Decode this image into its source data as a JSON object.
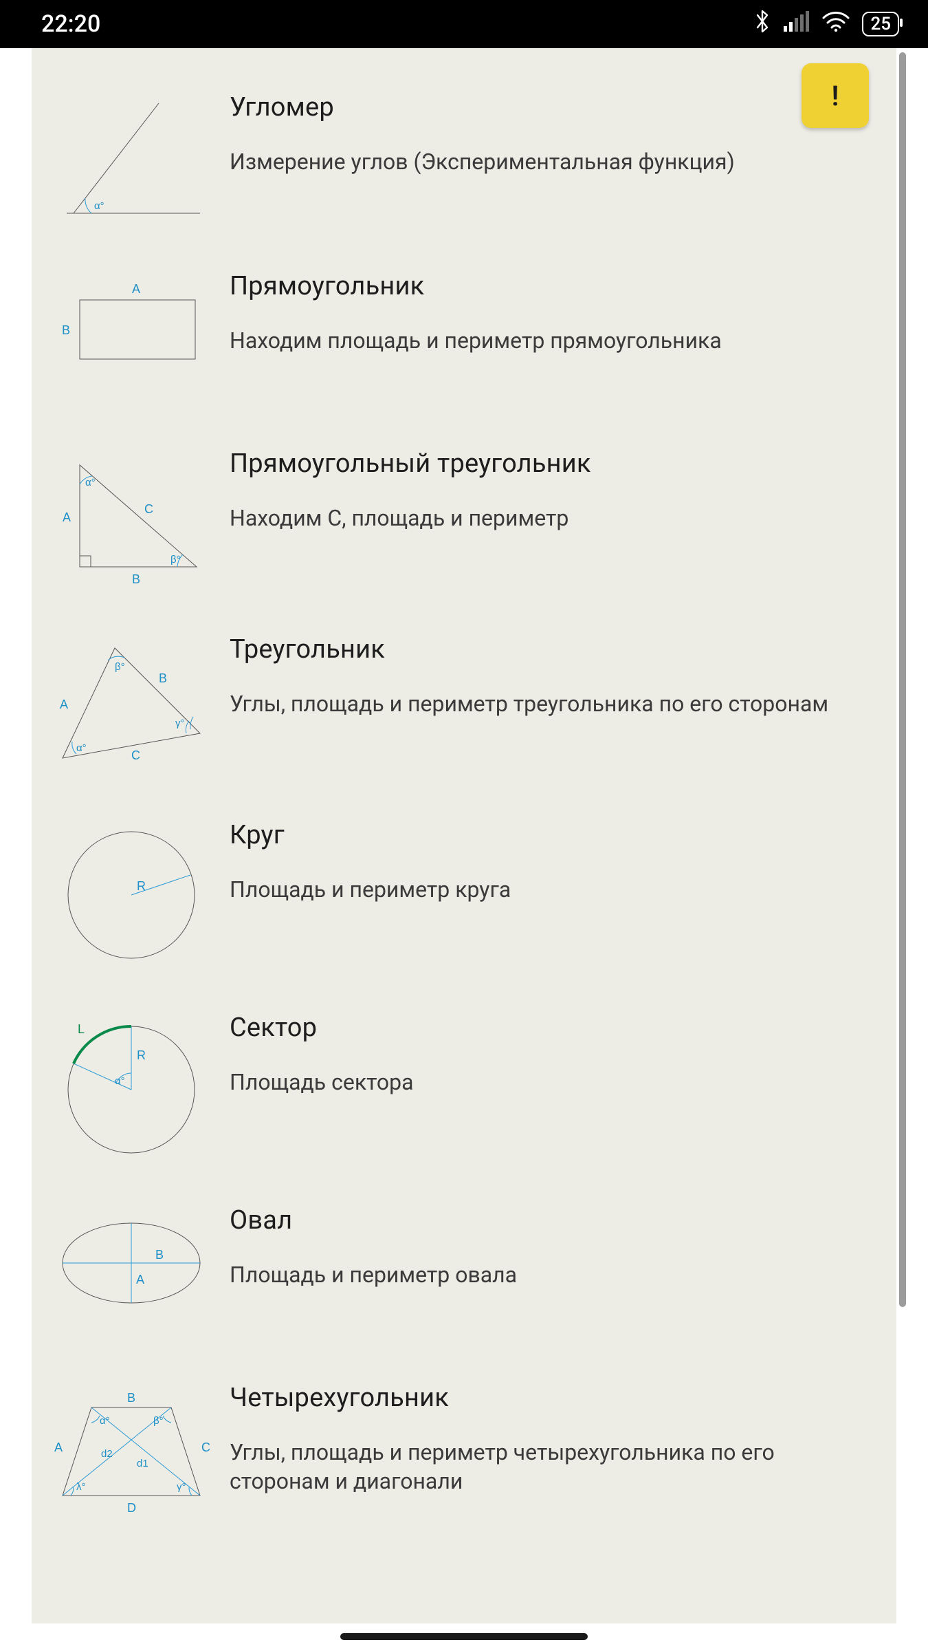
{
  "status": {
    "time": "22:20",
    "battery": "25"
  },
  "badge": {
    "label": "!"
  },
  "items": [
    {
      "title": "Угломер",
      "desc": "Измерение углов (Экспериментальная функция)",
      "icon": "protractor"
    },
    {
      "title": "Прямоугольник",
      "desc": "Находим площадь и периметр прямоугольника",
      "icon": "rectangle"
    },
    {
      "title": "Прямоугольный треугольник",
      "desc": "Находим C, площадь и периметр",
      "icon": "right-triangle"
    },
    {
      "title": "Треугольник",
      "desc": "Углы, площадь и периметр треугольника по его сторонам",
      "icon": "triangle"
    },
    {
      "title": "Круг",
      "desc": "Площадь и периметр круга",
      "icon": "circle"
    },
    {
      "title": "Сектор",
      "desc": "Площадь сектора",
      "icon": "sector"
    },
    {
      "title": "Овал",
      "desc": "Площадь и периметр овала",
      "icon": "ellipse"
    },
    {
      "title": "Четырехугольник",
      "desc": "Углы, площадь и периметр четырехугольника по его сторонам и диагонали",
      "icon": "quadrilateral"
    }
  ]
}
